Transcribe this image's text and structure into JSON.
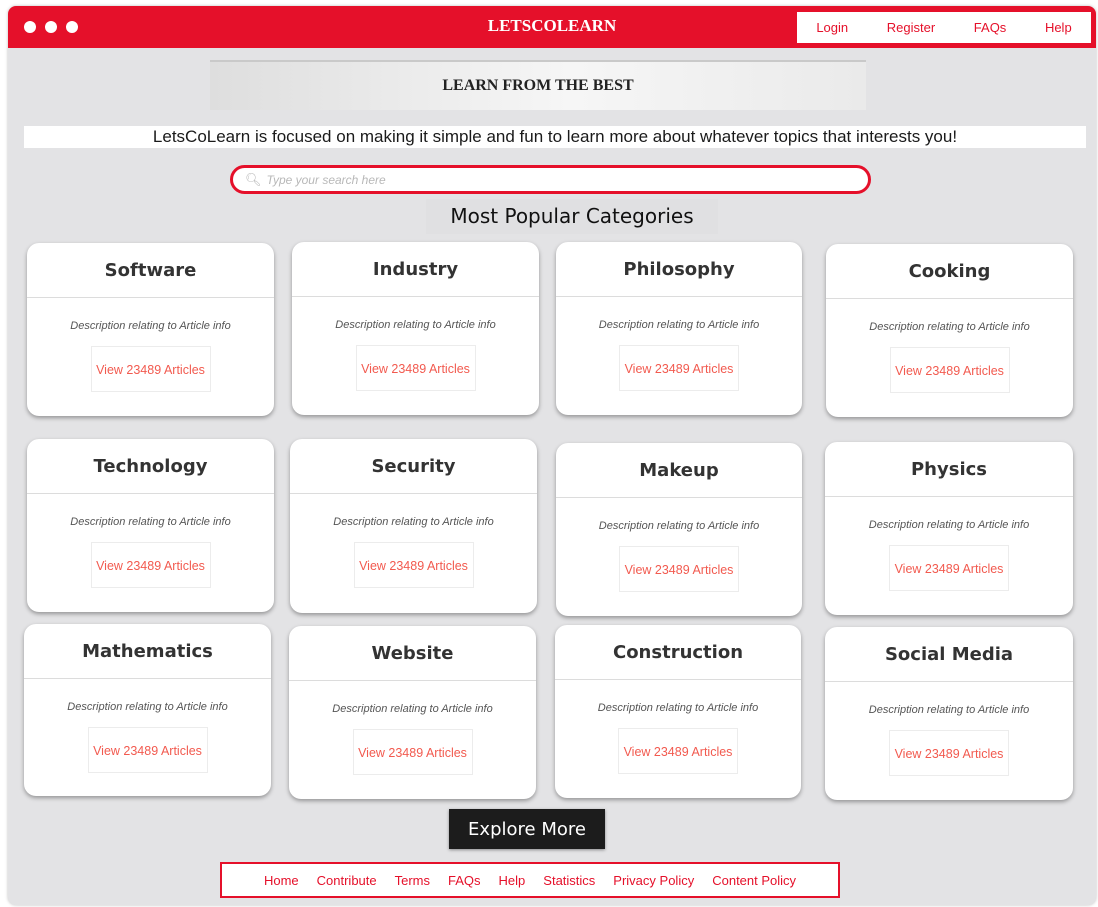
{
  "brand": "LETSCOLEARN",
  "topnav": [
    "Login",
    "Register",
    "FAQs",
    "Help"
  ],
  "hero": "LEARN FROM THE BEST",
  "tagline": "LetsCoLearn is focused on making it simple and fun to learn more about whatever topics that interests you!",
  "search": {
    "placeholder": "Type your search here",
    "icon": "search-icon"
  },
  "section_title": "Most Popular Categories",
  "categories": [
    {
      "title": "Software",
      "desc": "Description relating to Article info",
      "link": "View 23489 Articles"
    },
    {
      "title": "Industry",
      "desc": "Description relating to Article info",
      "link": "View 23489 Articles"
    },
    {
      "title": "Philosophy",
      "desc": "Description relating to Article info",
      "link": "View 23489 Articles"
    },
    {
      "title": "Cooking",
      "desc": "Description relating to Article info",
      "link": "View 23489 Articles"
    },
    {
      "title": "Technology",
      "desc": "Description relating to Article info",
      "link": "View 23489 Articles"
    },
    {
      "title": "Security",
      "desc": "Description relating to Article info",
      "link": "View 23489 Articles"
    },
    {
      "title": "Makeup",
      "desc": "Description relating to Article info",
      "link": "View 23489 Articles"
    },
    {
      "title": "Physics",
      "desc": "Description relating to Article info",
      "link": "View 23489 Articles"
    },
    {
      "title": "Mathematics",
      "desc": "Description relating to Article info",
      "link": "View 23489 Articles"
    },
    {
      "title": "Website",
      "desc": "Description relating to Article info",
      "link": "View 23489 Articles"
    },
    {
      "title": "Construction",
      "desc": "Description relating to Article info",
      "link": "View 23489 Articles"
    },
    {
      "title": "Social Media",
      "desc": "Description relating to Article info",
      "link": "View 23489 Articles"
    }
  ],
  "explore": "Explore More",
  "footer": [
    "Home",
    "Contribute",
    "Terms",
    "FAQs",
    "Help",
    "Statistics",
    "Privacy Policy",
    "Content Policy"
  ],
  "colors": {
    "accent": "#e5102a",
    "link": "#f25a4f",
    "background": "#e3e3e5"
  }
}
